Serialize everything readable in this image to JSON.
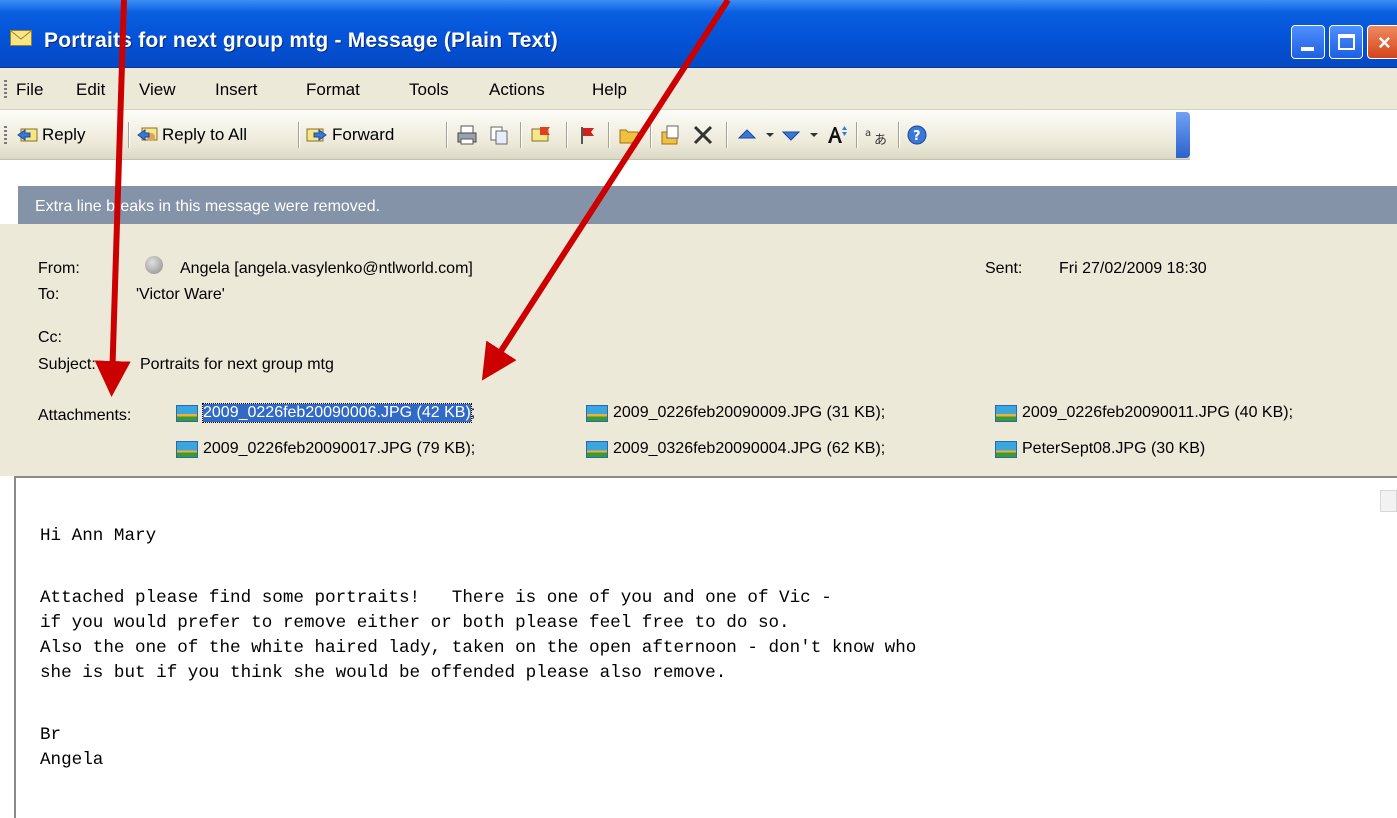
{
  "window": {
    "title": "Portraits for next group mtg - Message (Plain Text)",
    "close_glyph": "×"
  },
  "menu": [
    "File",
    "Edit",
    "View",
    "Insert",
    "Format",
    "Tools",
    "Actions",
    "Help"
  ],
  "toolbar": {
    "reply_label": "Reply",
    "reply_all_label": "Reply to All",
    "forward_label": "Forward"
  },
  "infobar": {
    "text": "Extra line breaks in this message were removed."
  },
  "header": {
    "from_label": "From:",
    "from_value": "Angela [angela.vasylenko@ntlworld.com]",
    "sent_label": "Sent:",
    "sent_value": "Fri 27/02/2009 18:30",
    "to_label": "To:",
    "to_value": "'Victor Ware'",
    "cc_label": "Cc:",
    "subject_label": "Subject:",
    "subject_value": "Portraits for next group mtg",
    "attachments_label": "Attachments:"
  },
  "attachments": [
    {
      "name": "2009_0226feb20090006.JPG (42 KB)",
      "sep": ";",
      "selected": true
    },
    {
      "name": "2009_0226feb20090009.JPG (31 KB)",
      "sep": ";",
      "selected": false
    },
    {
      "name": "2009_0226feb20090011.JPG (40 KB)",
      "sep": ";",
      "selected": false
    },
    {
      "name": "2009_0226feb20090017.JPG (79 KB)",
      "sep": ";",
      "selected": false
    },
    {
      "name": "2009_0326feb20090004.JPG (62 KB)",
      "sep": ";",
      "selected": false
    },
    {
      "name": "PeterSept08.JPG (30 KB)",
      "sep": "",
      "selected": false
    }
  ],
  "body": {
    "lines": [
      "Hi Ann Mary",
      "Attached please find some portraits!   There is one of you and one of Vic -",
      "if you would prefer to remove either or both please feel free to do so.",
      "Also the one of the white haired lady, taken on the open afternoon - don't know who",
      "she is but if you think she would be offended please also remove.",
      "Br",
      "Angela"
    ]
  },
  "colors": {
    "titlebar": "#0453d8",
    "chrome": "#ece9d8",
    "infobar": "#8593a8",
    "selection": "#316ac5",
    "annotation_arrow": "#cc0000"
  },
  "icons": [
    "envelope-icon",
    "reply-icon",
    "reply-all-icon",
    "forward-icon",
    "print-icon",
    "copy-icon",
    "flag-icon",
    "follow-up-icon",
    "folder-icon",
    "move-icon",
    "delete-icon",
    "previous-icon",
    "next-icon",
    "font-size-icon",
    "encoding-icon",
    "help-icon",
    "contact-avatar-icon",
    "image-file-icon"
  ]
}
